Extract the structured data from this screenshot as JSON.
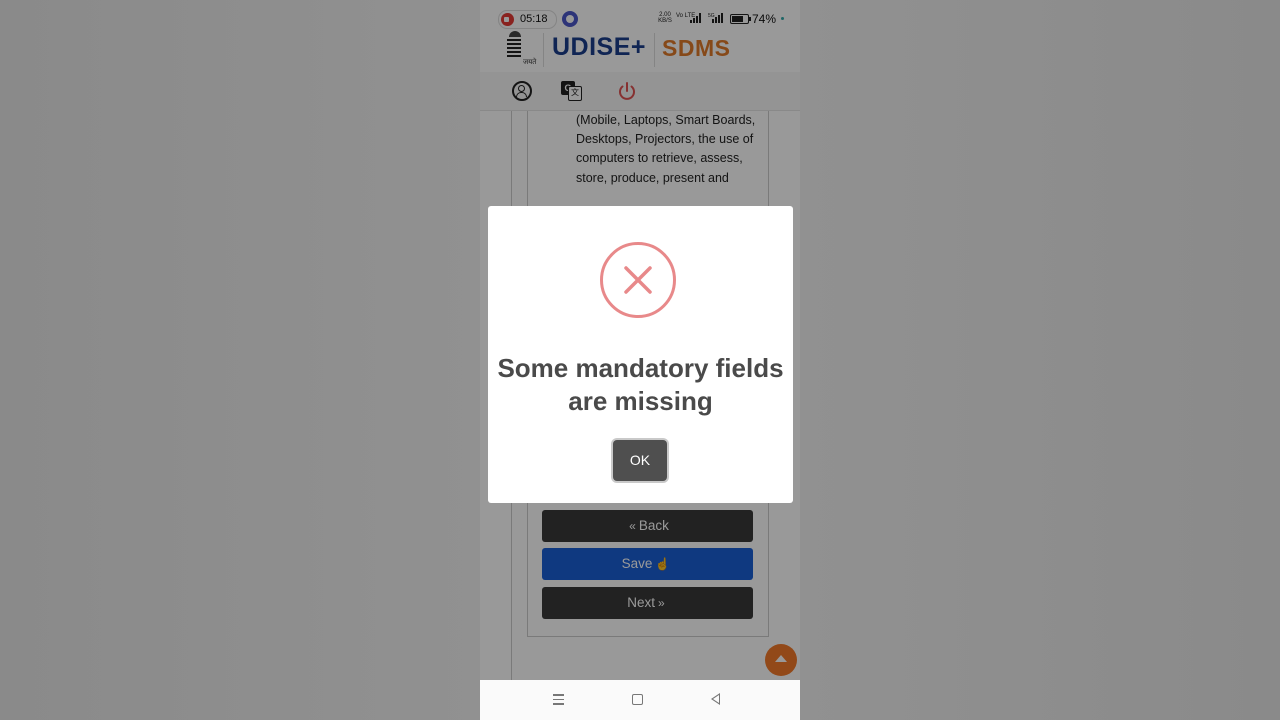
{
  "status_bar": {
    "record_time": "05:18",
    "net_speed": "2.00 KB/S",
    "volte": "Vo LTE",
    "battery_percent": "74%"
  },
  "header": {
    "brand_primary": "UDISE+",
    "brand_secondary": "SDMS",
    "emblem_motto": "जयते"
  },
  "toolbar": {
    "icons": [
      "user-icon",
      "translate-icon",
      "power-icon"
    ],
    "translate_letters": [
      "G",
      "文"
    ]
  },
  "content": {
    "paragraph": "(Mobile, Laptops, Smart Boards, Desktops, Projectors, the use of computers to retrieve, assess, store, produce, present and"
  },
  "buttons": {
    "back": "Back",
    "save": "Save",
    "next": "Next"
  },
  "dialog": {
    "message": "Some mandatory fields are missing",
    "ok_label": "OK"
  },
  "colors": {
    "brand_blue": "#1b3f8c",
    "brand_orange": "#e07b2a",
    "save_blue": "#1a5fd6",
    "error_red": "#e8898a",
    "scroll_top": "#f47a2a"
  }
}
